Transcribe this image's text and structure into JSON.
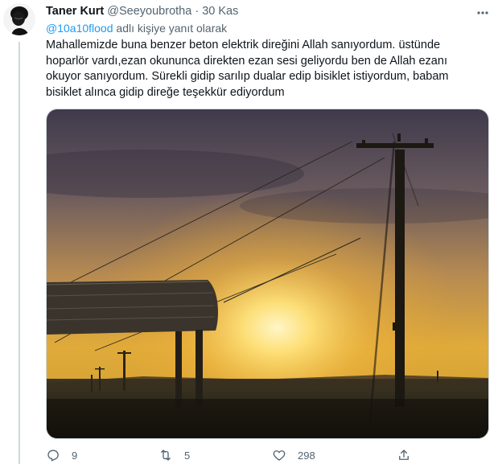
{
  "tweet": {
    "author_name": "Taner Kurt",
    "handle": "@Seeyoubrotha",
    "separator": "·",
    "time": "30 Kas",
    "reply_mention": "@10a10flood",
    "reply_suffix": "adlı kişiye yanıt olarak",
    "text": "Mahallemizde buna benzer beton elektrik direğini Allah sanıyordum. üstünde\nhoparlör vardı,ezan okununca direkten ezan sesi geliyordu ben de Allah ezanı\nokuyor sanıyordum. Sürekli gidip sarılıp dualar edip bisiklet istiyordum, babam\nbisiklet alınca  gidip direğe teşekkür ediyordum"
  },
  "icons": {
    "more": "more-dots-icon",
    "reply": "reply-icon",
    "retweet": "retweet-icon",
    "like": "like-icon",
    "share": "share-icon"
  },
  "actions": {
    "reply_count": "9",
    "retweet_count": "5",
    "like_count": "298"
  },
  "colors": {
    "text": "#0f1419",
    "secondary": "#536471",
    "link": "#1d9bf0",
    "thread_line": "#cfd9de"
  }
}
